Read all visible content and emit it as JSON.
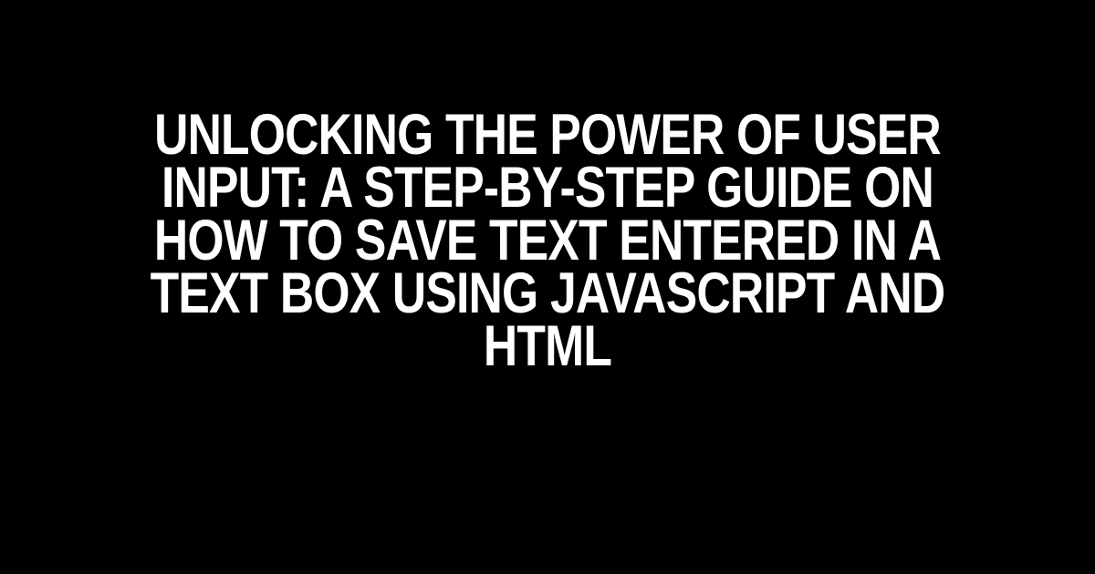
{
  "title": "Unlocking the Power of User Input: A Step-by-Step Guide on How to Save Text Entered in a Text Box using JavaScript and HTML"
}
